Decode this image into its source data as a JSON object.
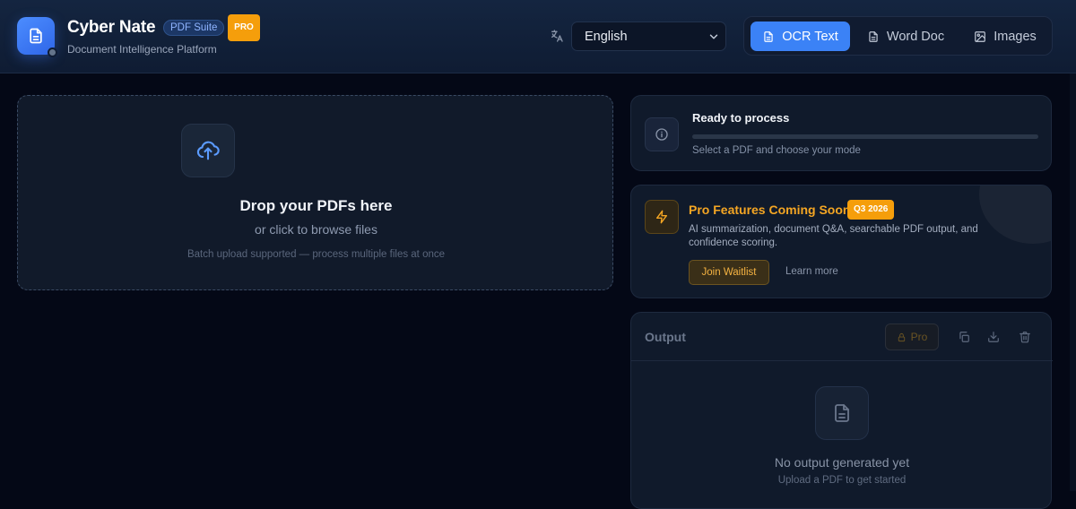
{
  "header": {
    "brand_name": "Cyber Nate",
    "suite_badge": "PDF Suite",
    "pro_badge": "PRO",
    "subtitle": "Document Intelligence Platform",
    "language": {
      "icon": "translate-icon",
      "selected": "English"
    },
    "modes": [
      {
        "label": "OCR Text",
        "icon": "document-icon",
        "active": true
      },
      {
        "label": "Word Doc",
        "icon": "document-icon",
        "active": false
      },
      {
        "label": "Images",
        "icon": "image-icon",
        "active": false
      }
    ]
  },
  "dropzone": {
    "icon": "cloud-upload-icon",
    "title": "Drop your PDFs here",
    "subtitle": "or click to browse files",
    "note": "Batch upload supported — process multiple files at once"
  },
  "status": {
    "icon": "info-icon",
    "title": "Ready to process",
    "progress": 0,
    "subtitle": "Select a PDF and choose your mode"
  },
  "pro_features": {
    "icon": "lightning-icon",
    "title": "Pro Features Coming Soon",
    "badge": "Q3 2026",
    "description": "AI summarization, document Q&A, searchable PDF output, and confidence scoring.",
    "join_label": "Join Waitlist",
    "learn_label": "Learn more"
  },
  "output": {
    "title": "Output",
    "pro_label": "Pro",
    "tools": [
      "copy-icon",
      "download-icon",
      "trash-icon"
    ],
    "empty_title": "No output generated yet",
    "empty_subtitle": "Upload a PDF to get started"
  },
  "colors": {
    "accent": "#3b82f6",
    "pro": "#f59e0b",
    "background": "#040816"
  }
}
